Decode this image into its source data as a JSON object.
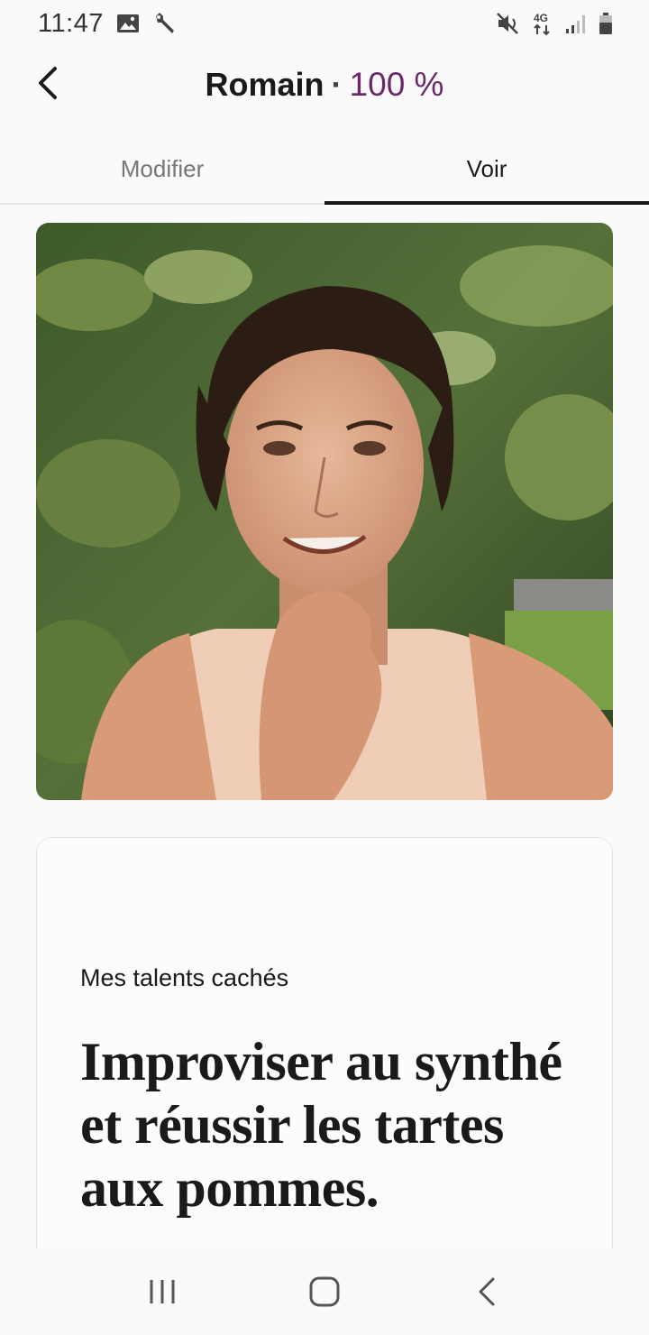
{
  "status_bar": {
    "time": "11:47",
    "icons": [
      "image-icon",
      "wrench-icon",
      "mute-vibrate-icon",
      "network-4g-icon",
      "signal-icon",
      "battery-icon"
    ],
    "network_label": "4G"
  },
  "header": {
    "name": "Romain",
    "separator": "·",
    "completion": "100 %"
  },
  "tabs": [
    {
      "label": "Modifier",
      "active": false
    },
    {
      "label": "Voir",
      "active": true
    }
  ],
  "profile": {
    "photo_alt": "Romain"
  },
  "prompt": {
    "label": "Mes talents cachés",
    "answer": "Improviser au synthé et réussir les tartes aux pommes."
  },
  "nav_bar": {
    "icons": [
      "recent-apps-icon",
      "home-icon",
      "back-icon"
    ]
  },
  "colors": {
    "accent": "#6b2a67",
    "text": "#1a1a1a",
    "background": "#fafafa"
  }
}
